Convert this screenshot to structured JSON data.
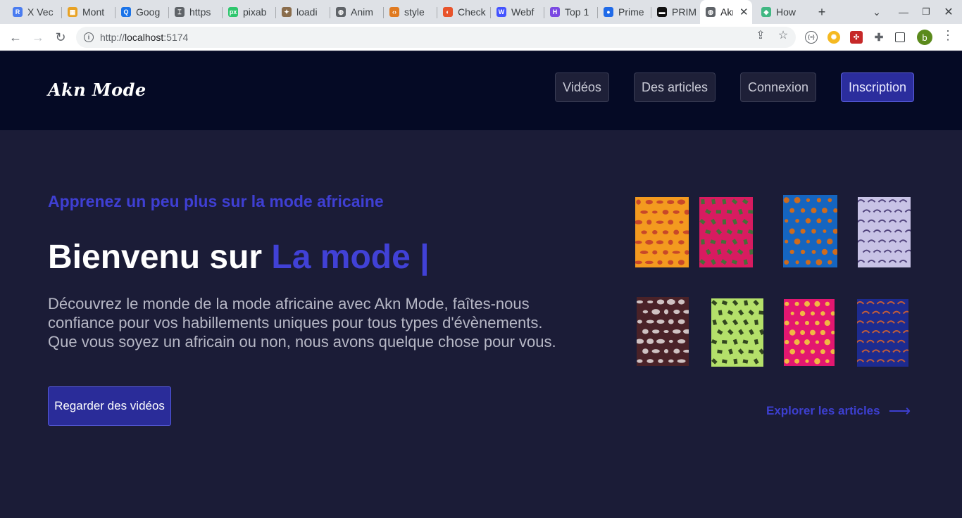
{
  "browser": {
    "tabs": [
      {
        "label": "X Vec",
        "favicon_color": "#4a7cf0",
        "favicon": "R"
      },
      {
        "label": "Mont",
        "favicon_color": "#e8a224",
        "favicon": "▦"
      },
      {
        "label": "Goog",
        "favicon_color": "#1a73e8",
        "favicon": "Q"
      },
      {
        "label": "https",
        "favicon_color": "#5f6368",
        "favicon": "⌶"
      },
      {
        "label": "pixab",
        "favicon_color": "#2ec66d",
        "favicon": "px"
      },
      {
        "label": "loadi",
        "favicon_color": "#8a6d4c",
        "favicon": "✦"
      },
      {
        "label": "Anim",
        "favicon_color": "#5f6368",
        "favicon": "◍"
      },
      {
        "label": "style",
        "favicon_color": "#e07a20",
        "favicon": "‹›"
      },
      {
        "label": "Check",
        "favicon_color": "#e8542c",
        "favicon": "◐"
      },
      {
        "label": "Webf",
        "favicon_color": "#4353ff",
        "favicon": "W"
      },
      {
        "label": "Top 1",
        "favicon_color": "#7b4ae2",
        "favicon": "H"
      },
      {
        "label": "Prime",
        "favicon_color": "#1f6ae8",
        "favicon": "●"
      },
      {
        "label": "PRIM",
        "favicon_color": "#111111",
        "favicon": "▬"
      },
      {
        "label": "Akn",
        "favicon_color": "#5f6368",
        "favicon": "◍",
        "active": true
      },
      {
        "label": "How",
        "favicon_color": "#41b883",
        "favicon": "◆"
      }
    ],
    "new_tab": "+",
    "url_scheme": "http://",
    "url_host": "localhost",
    "url_rest": ":5174",
    "profile_initial": "b"
  },
  "site": {
    "logo": "Akn Mode",
    "nav": [
      {
        "label": "Vidéos"
      },
      {
        "label": "Des articles"
      },
      {
        "label": "Connexion"
      },
      {
        "label": "Inscription",
        "primary": true
      }
    ],
    "hero": {
      "eyebrow": "Apprenez un peu plus sur la mode africaine",
      "headline_prefix": "Bienvenu sur ",
      "headline_accent": "La mode |",
      "description": "Découvrez le monde de la mode africaine avec Akn Mode, faîtes-nous confiance pour vos habillements uniques pour tous types d'évènements. Que vous soyez un africain ou non, nous avons quelque chose pour vous.",
      "cta": "Regarder des vidéos",
      "explore": "Explorer les articles",
      "explore_arrow": "⟶"
    },
    "fabrics": [
      {
        "name": "fabric-orange-wax",
        "bg": "#f39a1f",
        "fg": "#c0392b"
      },
      {
        "name": "fabric-green-pink-wax",
        "bg": "#d81b60",
        "fg": "#2e7d32"
      },
      {
        "name": "fabric-blue-orange-wax",
        "bg": "#1565c0",
        "fg": "#ef6c00"
      },
      {
        "name": "fabric-lilac-dots-wax",
        "bg": "#c8c3e6",
        "fg": "#3d2f6b"
      },
      {
        "name": "fabric-brown-white-wax",
        "bg": "#4a2228",
        "fg": "#e6dede"
      },
      {
        "name": "fabric-green-eyes-wax",
        "bg": "#b4e06a",
        "fg": "#1b2a12"
      },
      {
        "name": "fabric-pink-yellow-wax",
        "bg": "#e31770",
        "fg": "#f5d43b"
      },
      {
        "name": "fabric-navy-orange-wax",
        "bg": "#1d2b8f",
        "fg": "#e0662a"
      }
    ],
    "colors": {
      "header_bg": "#050a25",
      "page_bg": "#1b1c37",
      "accent": "#4141d6",
      "primary_button": "#2a2c99"
    }
  }
}
